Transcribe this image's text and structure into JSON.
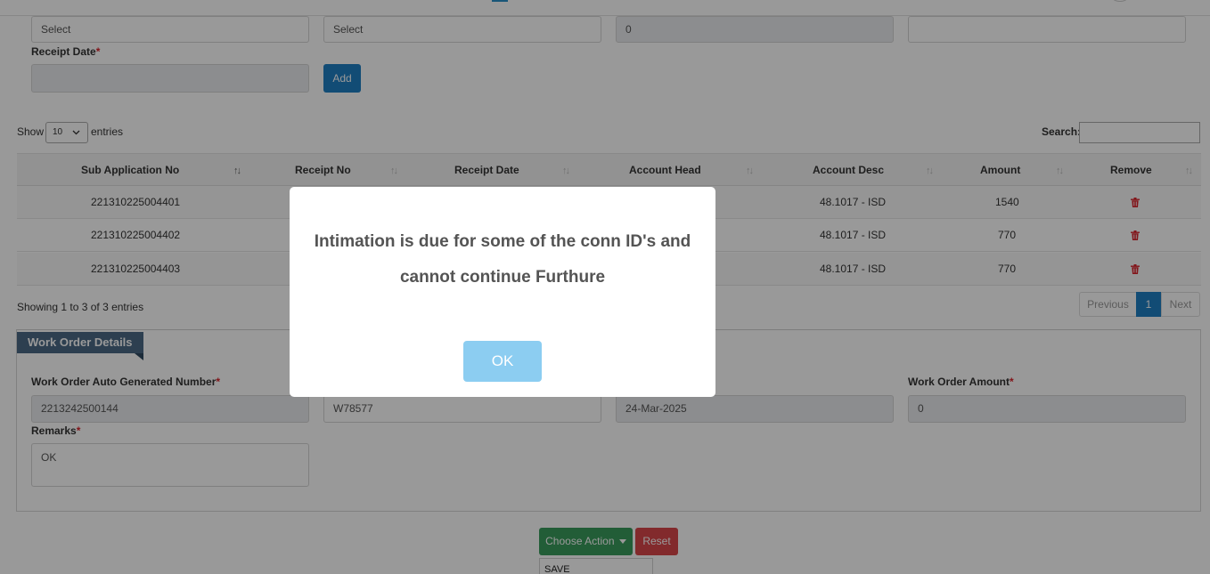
{
  "top_fields": {
    "field1_value": "Select",
    "field2_value": "Select",
    "field3_value": "0",
    "field4_value": ""
  },
  "receipt_date": {
    "label": "Receipt Date",
    "required_mark": "*",
    "value": ""
  },
  "add_button_label": "Add",
  "table_controls": {
    "show_label": "Show",
    "entries_select": "10",
    "entries_label": "entries",
    "search_label": "Search:",
    "search_value": ""
  },
  "table": {
    "columns": [
      "Sub Application No",
      "Receipt No",
      "Receipt Date",
      "Account Head",
      "Account Desc",
      "Amount",
      "Remove"
    ],
    "rows": [
      {
        "sub_application_no": "221310225004401",
        "receipt_no": "",
        "receipt_date": "",
        "account_head": "",
        "account_desc": "48.1017 - ISD",
        "amount": "1540"
      },
      {
        "sub_application_no": "221310225004402",
        "receipt_no": "",
        "receipt_date": "",
        "account_head": "",
        "account_desc": "48.1017 - ISD",
        "amount": "770"
      },
      {
        "sub_application_no": "221310225004403",
        "receipt_no": "",
        "receipt_date": "",
        "account_head": "",
        "account_desc": "48.1017 - ISD",
        "amount": "770"
      }
    ],
    "info": "Showing 1 to 3 of 3 entries",
    "pagination": {
      "previous": "Previous",
      "current": "1",
      "next": "Next"
    }
  },
  "work_order": {
    "section_title": "Work Order Details",
    "auto_number_label": "Work Order Auto Generated Number",
    "auto_number_value": "2213242500144",
    "work_order_no_value": "W78577",
    "work_order_date_value": "24-Mar-2025",
    "amount_label": "Work Order Amount",
    "amount_value": "0",
    "remarks_label": "Remarks",
    "remarks_value": "OK",
    "required_mark": "*"
  },
  "actions": {
    "choose_action_label": "Choose Action",
    "reset_label": "Reset",
    "dropdown_first_item": "SAVE"
  },
  "modal": {
    "message_line1": "Intimation is due for some of the conn ID's and",
    "message_line2": "cannot continue Furthure",
    "ok_label": "OK"
  },
  "colors": {
    "primary_blue": "#1f7fc3",
    "ribbon": "#4b6a86",
    "success_green": "#3a9b5d",
    "danger_red": "#d9474a",
    "ok_button": "#8ccdf1"
  }
}
